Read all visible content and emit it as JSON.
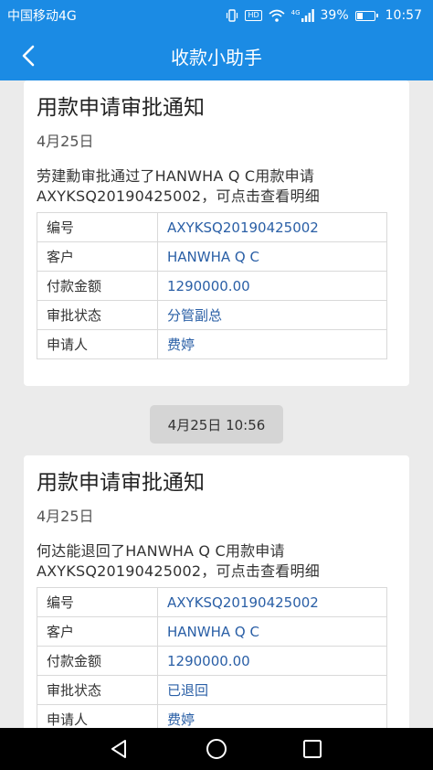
{
  "status_bar": {
    "carrier": "中国移动4G",
    "network": "4G",
    "hd": "HD",
    "battery": "39%",
    "battery_level": 0.39,
    "time": "10:57"
  },
  "header": {
    "title": "收款小助手"
  },
  "cards": [
    {
      "title": "用款申请审批通知",
      "date": "4月25日",
      "description": "劳建勳审批通过了HANWHA Q C用款申请AXYKSQ20190425002，可点击查看明细",
      "rows": [
        {
          "label": "编号",
          "value": "AXYKSQ20190425002"
        },
        {
          "label": "客户",
          "value": "HANWHA Q C"
        },
        {
          "label": "付款金额",
          "value": "1290000.00"
        },
        {
          "label": "审批状态",
          "value": "分管副总"
        },
        {
          "label": "申请人",
          "value": "费婷"
        }
      ]
    },
    {
      "title": "用款申请审批通知",
      "date": "4月25日",
      "description": "何达能退回了HANWHA Q C用款申请AXYKSQ20190425002，可点击查看明细",
      "rows": [
        {
          "label": "编号",
          "value": "AXYKSQ20190425002"
        },
        {
          "label": "客户",
          "value": "HANWHA Q C"
        },
        {
          "label": "付款金额",
          "value": "1290000.00"
        },
        {
          "label": "审批状态",
          "value": "已退回"
        },
        {
          "label": "申请人",
          "value": "费婷"
        }
      ]
    }
  ],
  "timestamp": "4月25日 10:56",
  "colors": {
    "primary": "#1b8be4",
    "value_text": "#2a5fa6",
    "background": "#ebebeb"
  },
  "icons": {
    "back": "chevron-left-icon",
    "nav": [
      "back-triangle-icon",
      "home-circle-icon",
      "recents-square-icon"
    ]
  }
}
